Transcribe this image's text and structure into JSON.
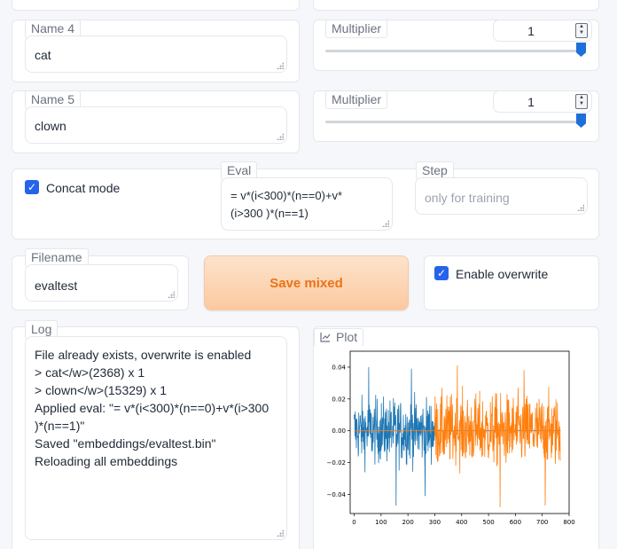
{
  "name4": {
    "label": "Name 4",
    "value": "cat"
  },
  "name5": {
    "label": "Name 5",
    "value": "clown"
  },
  "multiplier4": {
    "label": "Multiplier",
    "value": "1",
    "slider_fraction": 1.0
  },
  "multiplier5": {
    "label": "Multiplier",
    "value": "1",
    "slider_fraction": 1.0
  },
  "concat": {
    "label": "Concat mode",
    "checked": true
  },
  "eval": {
    "label": "Eval",
    "line1": "= v*(i<300)*(n==0)+v*",
    "line2": "(i>300 )*(n==1)"
  },
  "step": {
    "label": "Step",
    "placeholder": "only for training"
  },
  "filename": {
    "label": "Filename",
    "value": "evaltest"
  },
  "save_button": {
    "label": "Save mixed"
  },
  "overwrite": {
    "label": "Enable overwrite",
    "checked": true
  },
  "log": {
    "label": "Log",
    "lines": [
      "File already exists, overwrite is enabled",
      "> cat</w>(2368) x 1",
      "> clown</w>(15329) x 1",
      "Applied eval: \"= v*(i<300)*(n==0)+v*(i>300",
      ")*(n==1)\"",
      "Saved \"embeddings/evaltest.bin\"",
      "Reloading all embeddings"
    ]
  },
  "plot": {
    "label": "Plot",
    "icon": "chart-icon"
  },
  "colors": {
    "accent": "#2563eb",
    "save_text": "#ea7317",
    "series1": "#1f77b4",
    "series2": "#ff7f0e"
  },
  "chart_data": {
    "type": "line",
    "x_ticks": [
      0,
      100,
      200,
      300,
      400,
      500,
      600,
      700,
      800
    ],
    "y_ticks": [
      -0.04,
      -0.02,
      0.0,
      0.02,
      0.04
    ],
    "y_tick_labels": [
      "−0.04",
      "−0.02",
      "0.00",
      "0.02",
      "0.04"
    ],
    "xlim": [
      -15,
      800
    ],
    "ylim": [
      -0.052,
      0.05
    ],
    "series": [
      {
        "x_range": [
          0,
          300
        ],
        "amplitude": 0.018,
        "peaks": [
          0.04,
          -0.047,
          0.039,
          -0.041
        ],
        "color": "#1f77b4"
      },
      {
        "x_range": [
          300,
          768
        ],
        "amplitude": 0.02,
        "peaks": [
          0.041,
          -0.048,
          0.038,
          -0.047
        ],
        "color": "#ff7f0e"
      }
    ]
  }
}
